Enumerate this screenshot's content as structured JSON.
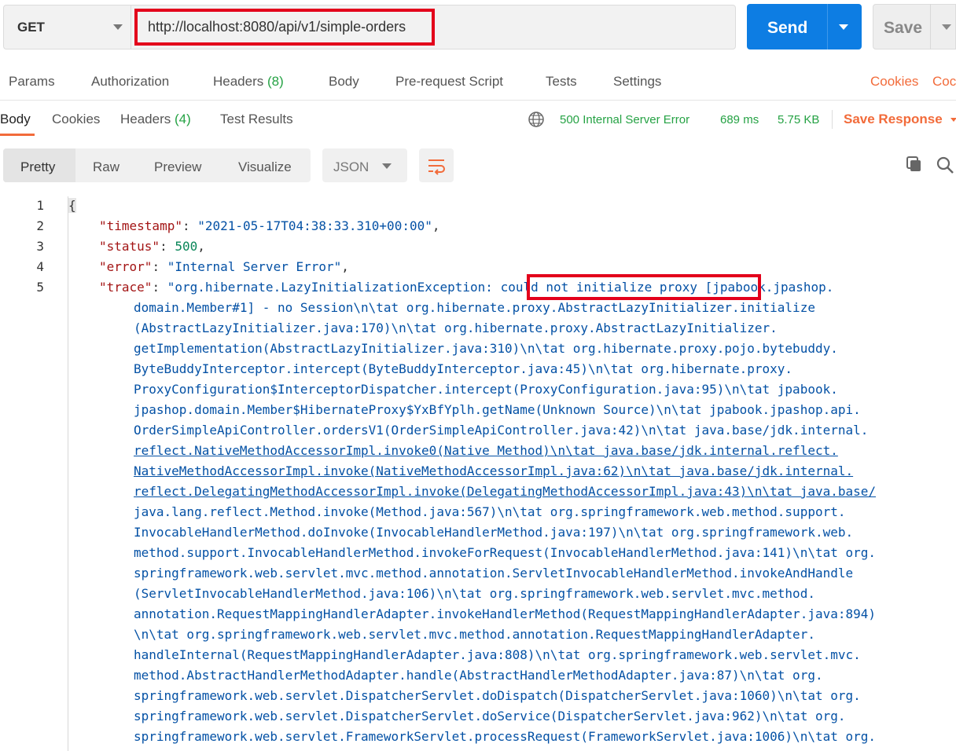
{
  "request": {
    "method": "GET",
    "url": "http://localhost:8080/api/v1/simple-orders",
    "send_label": "Send",
    "save_label": "Save"
  },
  "request_tabs": {
    "params": "Params",
    "authorization": "Authorization",
    "headers": "Headers",
    "headers_count": "(8)",
    "body": "Body",
    "prerequest": "Pre-request Script",
    "tests": "Tests",
    "settings": "Settings",
    "cookies": "Cookies",
    "code": "Coc"
  },
  "response_tabs": {
    "body": "Body",
    "cookies": "Cookies",
    "headers": "Headers",
    "headers_count": "(4)",
    "test_results": "Test Results"
  },
  "response_status": {
    "status": "500 Internal Server Error",
    "time": "689 ms",
    "size": "5.75 KB",
    "save_response": "Save Response"
  },
  "view_modes": {
    "pretty": "Pretty",
    "raw": "Raw",
    "preview": "Preview",
    "visualize": "Visualize",
    "format": "JSON"
  },
  "code": {
    "line_numbers": [
      "1",
      "2",
      "3",
      "4",
      "5"
    ],
    "open_brace": "{",
    "timestamp_key": "\"timestamp\"",
    "timestamp_value": "\"2021-05-17T04:38:33.310+00:00\"",
    "status_key": "\"status\"",
    "status_value": "500",
    "error_key": "\"error\"",
    "error_value": "\"Internal Server Error\"",
    "trace_key": "\"trace\"",
    "trace_first_a": "\"org.hibernate.LazyInitializationException:",
    "trace_first_b": "could not initialize proxy",
    "trace_first_c": "[jpabook.jpashop.",
    "trace_lines": [
      "domain.Member#1] - no Session\\n\\tat org.hibernate.proxy.AbstractLazyInitializer.initialize",
      "(AbstractLazyInitializer.java:170)\\n\\tat org.hibernate.proxy.AbstractLazyInitializer.",
      "getImplementation(AbstractLazyInitializer.java:310)\\n\\tat org.hibernate.proxy.pojo.bytebuddy.",
      "ByteBuddyInterceptor.intercept(ByteBuddyInterceptor.java:45)\\n\\tat org.hibernate.proxy.",
      "ProxyConfiguration$InterceptorDispatcher.intercept(ProxyConfiguration.java:95)\\n\\tat jpabook.",
      "jpashop.domain.Member$HibernateProxy$YxBfYplh.getName(Unknown Source)\\n\\tat jpabook.jpashop.api.",
      "OrderSimpleApiController.ordersV1(OrderSimpleApiController.java:42)\\n\\tat java.base/jdk.internal.",
      "reflect.NativeMethodAccessorImpl.invoke0(Native Method)\\n\\tat java.base/jdk.internal.reflect.",
      "NativeMethodAccessorImpl.invoke(NativeMethodAccessorImpl.java:62)\\n\\tat java.base/jdk.internal.",
      "reflect.DelegatingMethodAccessorImpl.invoke(DelegatingMethodAccessorImpl.java:43)\\n\\tat java.base/",
      "java.lang.reflect.Method.invoke(Method.java:567)\\n\\tat org.springframework.web.method.support.",
      "InvocableHandlerMethod.doInvoke(InvocableHandlerMethod.java:197)\\n\\tat org.springframework.web.",
      "method.support.InvocableHandlerMethod.invokeForRequest(InvocableHandlerMethod.java:141)\\n\\tat org.",
      "springframework.web.servlet.mvc.method.annotation.ServletInvocableHandlerMethod.invokeAndHandle",
      "(ServletInvocableHandlerMethod.java:106)\\n\\tat org.springframework.web.servlet.mvc.method.",
      "annotation.RequestMappingHandlerAdapter.invokeHandlerMethod(RequestMappingHandlerAdapter.java:894)",
      "\\n\\tat org.springframework.web.servlet.mvc.method.annotation.RequestMappingHandlerAdapter.",
      "handleInternal(RequestMappingHandlerAdapter.java:808)\\n\\tat org.springframework.web.servlet.mvc.",
      "method.AbstractHandlerMethodAdapter.handle(AbstractHandlerMethodAdapter.java:87)\\n\\tat org.",
      "springframework.web.servlet.DispatcherServlet.doDispatch(DispatcherServlet.java:1060)\\n\\tat org.",
      "springframework.web.servlet.DispatcherServlet.doService(DispatcherServlet.java:962)\\n\\tat org.",
      "springframework.web.servlet.FrameworkServlet.processRequest(FrameworkServlet.java:1006)\\n\\tat org."
    ]
  },
  "colors": {
    "send": "#0d7de3",
    "status_ok_green": "#25a244",
    "accent_orange": "#f26b3a",
    "highlight_red": "#e3001b"
  }
}
